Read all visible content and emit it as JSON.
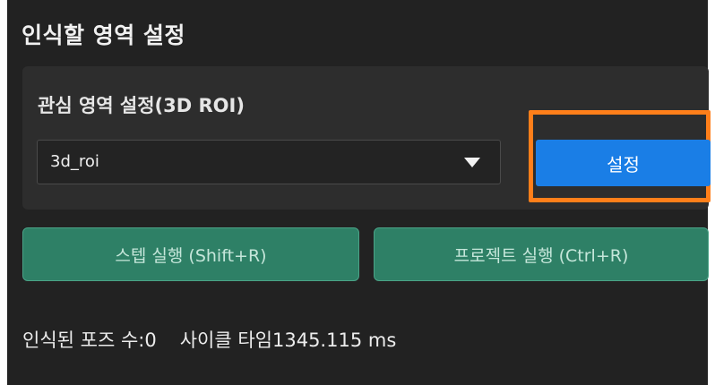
{
  "section": {
    "title": "인식할 영역 설정"
  },
  "roi_group": {
    "label": "관심 영역 설정(3D ROI)",
    "select_value": "3d_roi",
    "set_button_label": "설정"
  },
  "actions": {
    "step_run_label": "스텝 실행 (Shift+R)",
    "project_run_label": "프로젝트 실행 (Ctrl+R)"
  },
  "status": {
    "recognized_poses": "인식된 포즈 수:0",
    "cycle_time": "사이클 타임1345.115 ms"
  },
  "colors": {
    "background": "#222222",
    "group_box": "#2d2d2d",
    "primary_button": "#1a7ee6",
    "run_button": "#2e8066",
    "highlight": "#ff7f1a"
  },
  "icons": {
    "select_arrow": "caret-down-icon"
  }
}
